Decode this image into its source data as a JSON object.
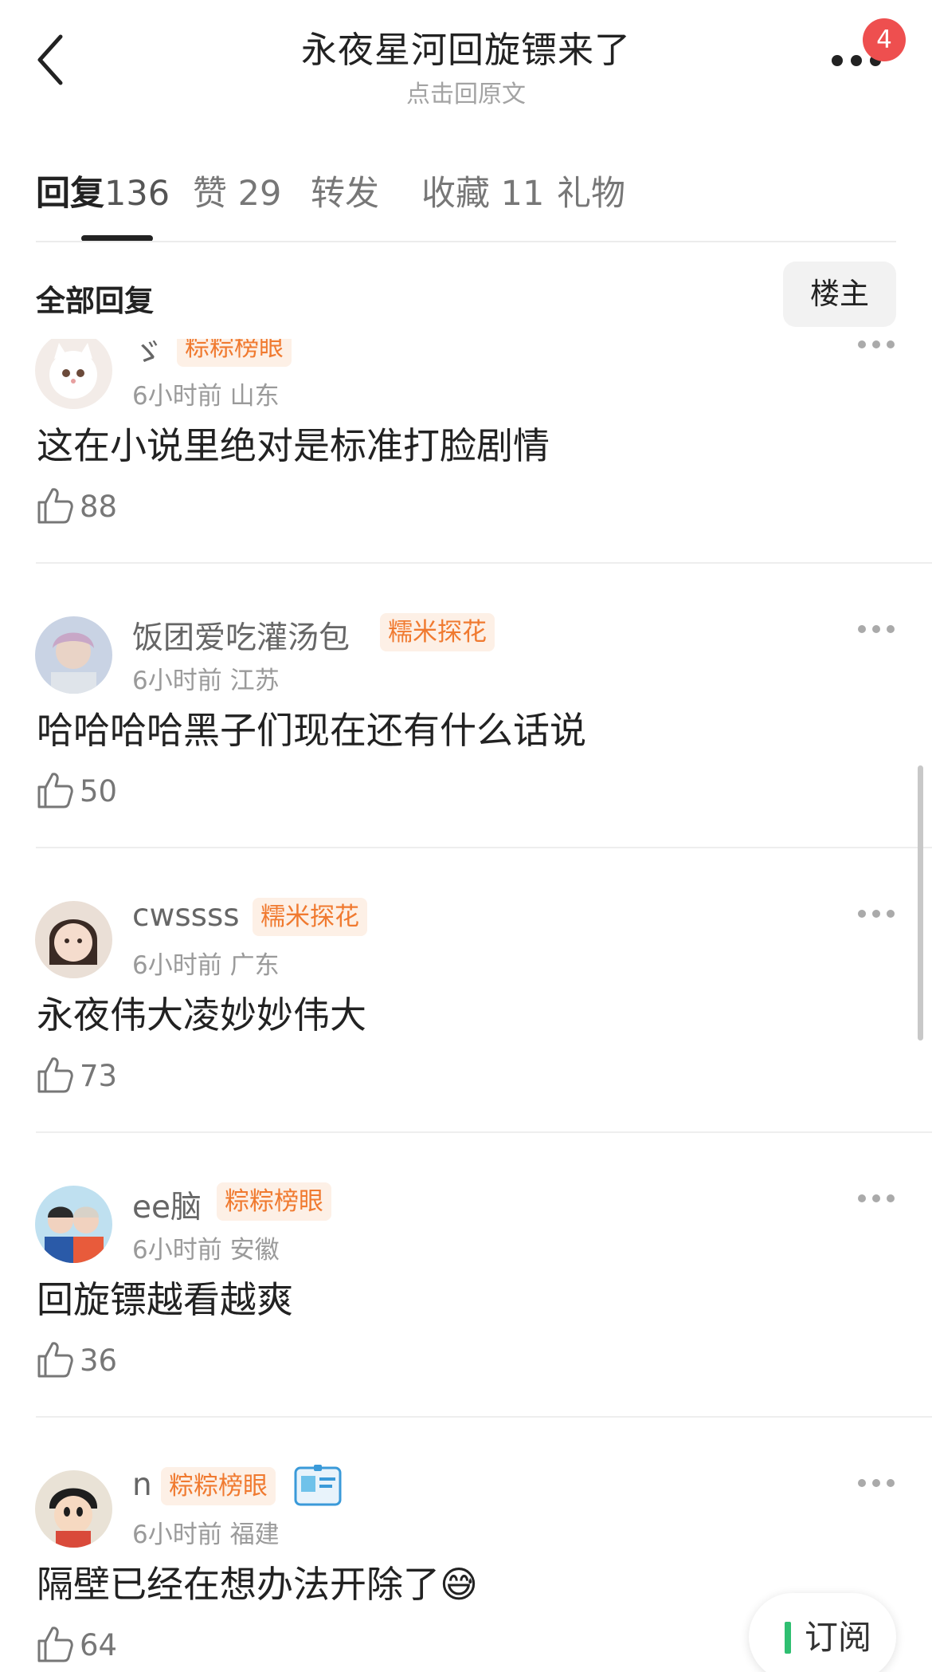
{
  "header": {
    "title": "永夜星河回旋镖来了",
    "subtitle": "点击回原文",
    "notification_count": "4"
  },
  "tabs": [
    {
      "label": "回复",
      "count": "136"
    },
    {
      "label": "赞",
      "count": "29"
    },
    {
      "label": "转发",
      "count": ""
    },
    {
      "label": "收藏",
      "count": "11"
    },
    {
      "label": "礼物",
      "count": ""
    }
  ],
  "section": {
    "title": "全部回复",
    "owner_button": "楼主"
  },
  "comments": [
    {
      "username": "ゞ",
      "tag": "粽粽榜眼",
      "time": "6小时前",
      "location": "山东",
      "text": "这在小说里绝对是标准打脸剧情",
      "likes": "88"
    },
    {
      "username": "饭团爱吃灌汤包",
      "tag": "糯米探花",
      "time": "6小时前",
      "location": "江苏",
      "text": "哈哈哈哈黑子们现在还有什么话说",
      "likes": "50"
    },
    {
      "username": "cwssss",
      "tag": "糯米探花",
      "time": "6小时前",
      "location": "广东",
      "text": "永夜伟大凌妙妙伟大",
      "likes": "73"
    },
    {
      "username": "ee脑",
      "tag": "粽粽榜眼",
      "time": "6小时前",
      "location": "安徽",
      "text": "回旋镖越看越爽",
      "likes": "36"
    },
    {
      "username": "n",
      "tag": "粽粽榜眼",
      "time": "6小时前",
      "location": "福建",
      "text": "隔壁已经在想办法开除了😅",
      "likes": "64"
    }
  ],
  "floating_button": {
    "label": "订阅"
  },
  "colors": {
    "accent_badge": "#ee4f4f",
    "tag_text": "#f07a30",
    "tag_bg": "#fdf0e6"
  }
}
